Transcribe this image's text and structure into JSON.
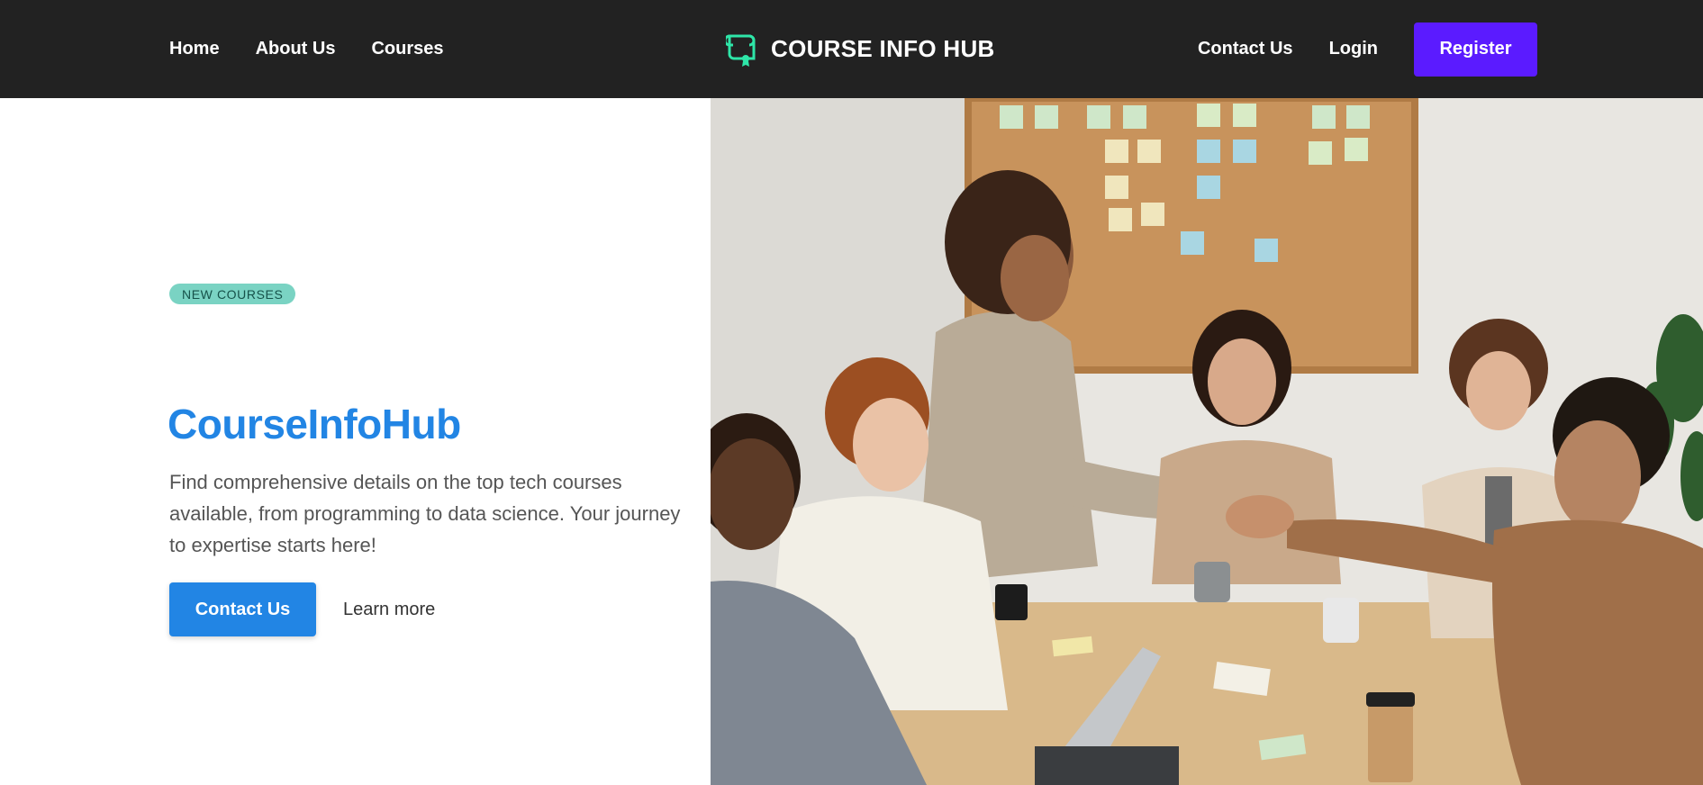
{
  "header": {
    "nav_left": [
      {
        "label": "Home"
      },
      {
        "label": "About Us"
      },
      {
        "label": "Courses"
      }
    ],
    "brand": {
      "text": "COURSE INFO HUB",
      "logo_icon": "certificate-icon",
      "logo_color": "#2ee6a8"
    },
    "nav_right": [
      {
        "label": "Contact Us"
      },
      {
        "label": "Login"
      }
    ],
    "register_label": "Register",
    "background": "#222222",
    "register_color": "#5b1bff"
  },
  "hero": {
    "badge": "NEW COURSES",
    "title": "CourseInfoHub",
    "description": "Find comprehensive details on the top tech courses available, from programming to data science. Your journey to expertise starts here!",
    "primary_button": "Contact Us",
    "secondary_link": "Learn more",
    "accent_color": "#2285e4",
    "badge_color": "#7ad3c3",
    "image": {
      "subject": "team-meeting-handshake-photo"
    }
  }
}
